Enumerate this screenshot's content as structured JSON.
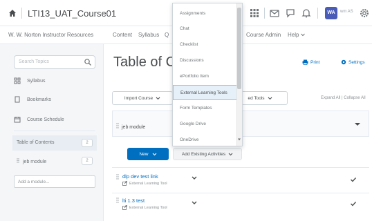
{
  "topbar": {
    "course_title": "LTI13_UAT_Course01",
    "avatar_initials": "WA",
    "user_name": "wm AS"
  },
  "navbar": {
    "items": [
      "W. W. Norton Instructor Resources",
      "Content",
      "Syllabus",
      "Q",
      "Course Admin",
      "Help"
    ]
  },
  "sidebar": {
    "search_placeholder": "Search Topics",
    "links": [
      "Syllabus",
      "Bookmarks",
      "Course Schedule"
    ],
    "toc_label": "Table of Contents",
    "toc_count": "2",
    "module_label": "jeb module",
    "module_count": "2",
    "add_module": "Add a module..."
  },
  "main": {
    "title": "Table of Co",
    "print_label": "Print",
    "settings_label": "Settings",
    "import_course": "Import Course",
    "related_tools": "ed Tools",
    "expand_all": "Expand All",
    "collapse_all": "Collapse All",
    "module_name": "jeb module",
    "new_button": "New",
    "add_existing": "Add Existing Activities",
    "topics": [
      {
        "title": "dlp dev test link",
        "type": "External Learning Tool"
      },
      {
        "title": "lti 1.3 test",
        "type": "External Learning Tool"
      }
    ]
  },
  "dropdown": {
    "items": [
      "Assignments",
      "Chat",
      "Checklist",
      "Discussions",
      "ePortfolio Item",
      "External Learning Tools",
      "Form Templates",
      "Google Drive",
      "OneDrive"
    ],
    "highlighted_index": 5
  },
  "colors": {
    "accent": "#006fbf",
    "avatar": "#4a5bb8",
    "highlight_bg": "#e6f0f8"
  }
}
